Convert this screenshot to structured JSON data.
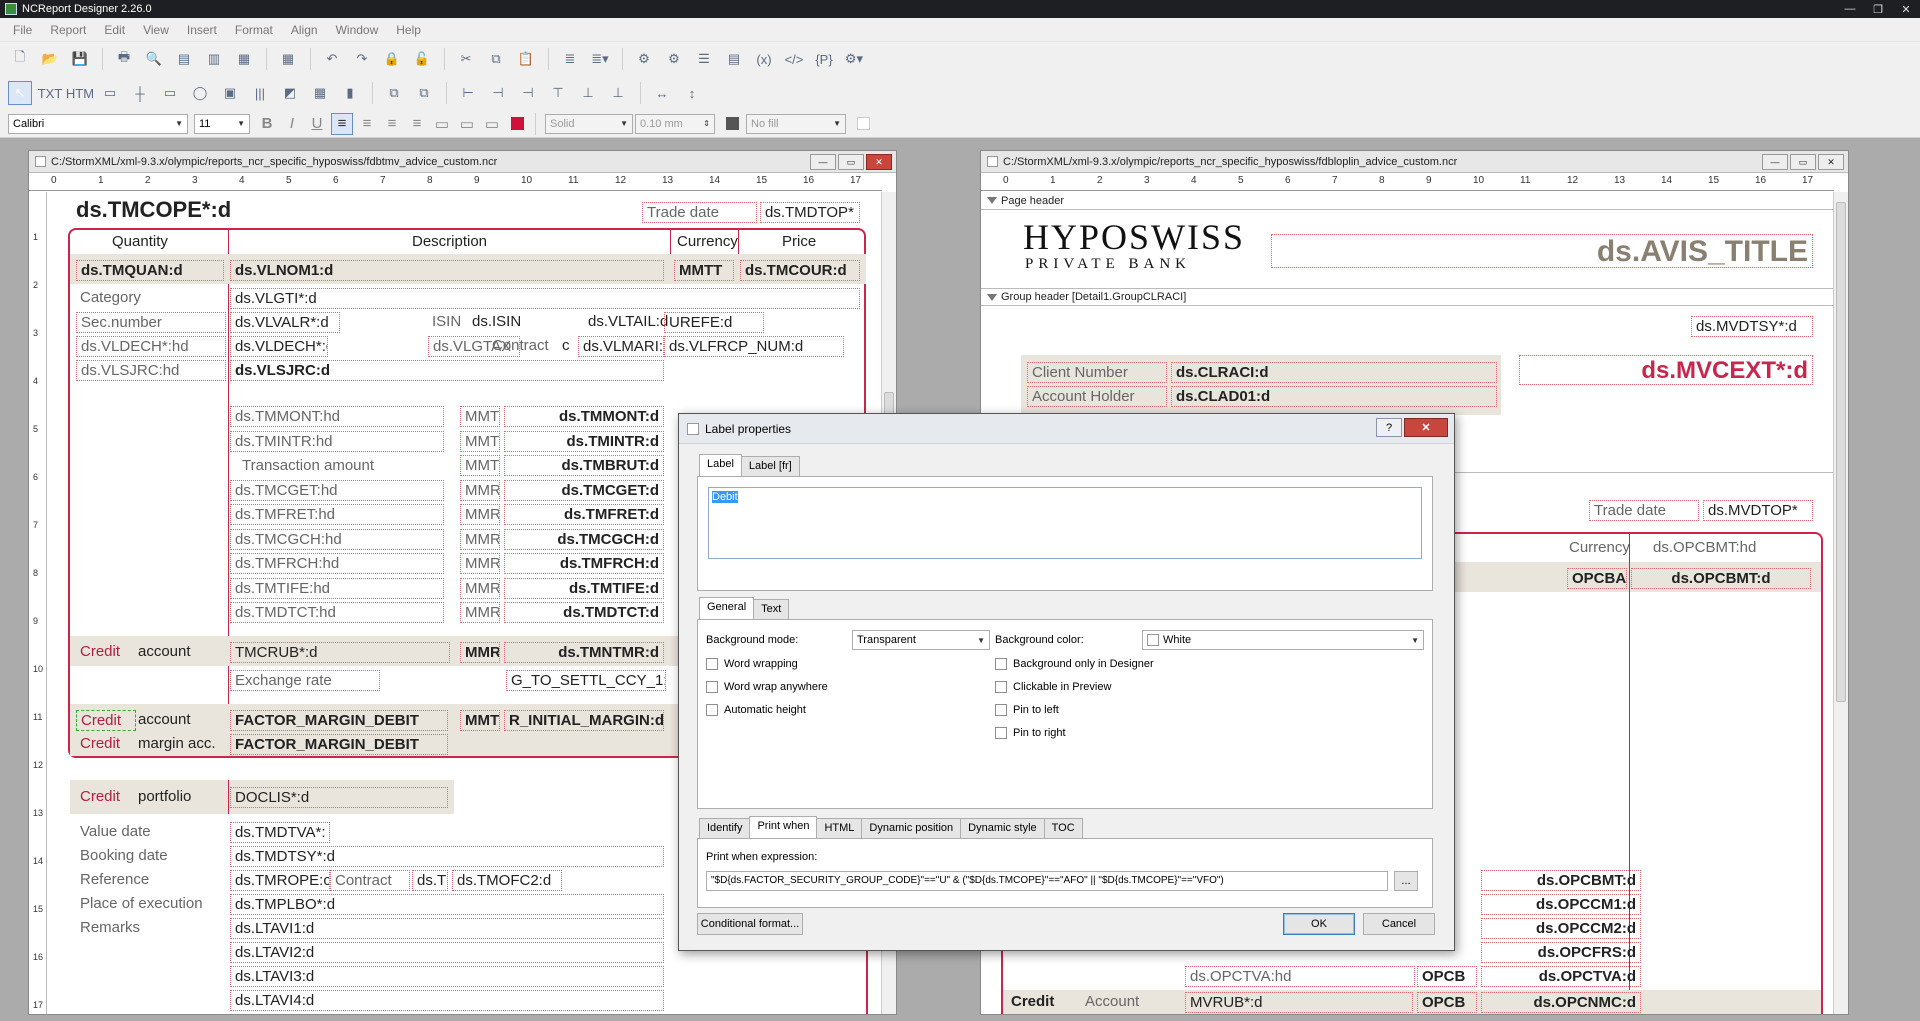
{
  "app_title": "NCReport Designer 2.26.0",
  "menu": [
    "File",
    "Report",
    "Edit",
    "View",
    "Insert",
    "Format",
    "Align",
    "Window",
    "Help"
  ],
  "format_toolbar": {
    "font": "Calibri",
    "size": "11",
    "line_style": "Solid",
    "line_width": "0.10 mm",
    "fill": "No fill"
  },
  "left_window": {
    "title": "C:/StormXML/xml-9.3.x/olympic/reports_ncr_specific_hyposwiss/fdbtmv_advice_custom.ncr",
    "ruler": [
      "0",
      "1",
      "2",
      "3",
      "4",
      "5",
      "6",
      "7",
      "8",
      "9",
      "10",
      "11",
      "12",
      "13",
      "14",
      "15",
      "16",
      "17"
    ],
    "vruler": [
      "1",
      "2",
      "3",
      "4",
      "5",
      "6",
      "7",
      "8",
      "9",
      "10",
      "11",
      "12",
      "13",
      "14",
      "15",
      "16",
      "17"
    ],
    "top_field": "ds.TMCOPE*:d",
    "trade_date_label": "Trade date",
    "trade_date_field": "ds.TMDTOP*",
    "headers": {
      "quantity": "Quantity",
      "description": "Description",
      "currency": "Currency",
      "price": "Price"
    },
    "row1": {
      "quan": "ds.TMQUAN:d",
      "nom": "ds.VLNOM1:d",
      "cur": "MMTT",
      "cour": "ds.TMCOUR:d"
    },
    "fields": {
      "category": "Category",
      "vlgti": "ds.VLGTI*:d",
      "secnumber": "Sec.number",
      "vlvalr": "ds.VLVALR*:d",
      "isin": "ISIN",
      "isin2": "ds.ISIN",
      "vltail": "ds.VLTAIL:d",
      "urefe": "UREFE:d",
      "vldech_hd": "ds.VLDECH*:hd",
      "vldech": "ds.VLDECH*:d",
      "vlgtax": "ds.VLGTAX",
      "contract": "Contract",
      "c": "c",
      "vlmari": "ds.VLMARI:d",
      "vlfrcp": "ds.VLFRCP_NUM:d",
      "vlsjrc_hd": "ds.VLSJRC:hd",
      "vlsjrc": "ds.VLSJRC:d",
      "exchange_rate": "Exchange rate",
      "settl": "G_TO_SETTL_CCY_1:d",
      "credit": "Credit",
      "debit": "Debit",
      "account": "account",
      "tmcrub": "TMCRUB*:d",
      "mmri": "MMRI",
      "tmntmr": "ds.TMNTMR:d",
      "factor1": "FACTOR_MARGIN_DEBIT",
      "factor2": "FACTOR_MARGIN_DEBIT",
      "mmt": "MMT",
      "initial": "R_INITIAL_MARGIN:d",
      "margin_acc": "margin acc.",
      "portfolio": "portfolio",
      "doclis": "DOCLIS*:d",
      "value_date": "Value date",
      "tmdtva": "ds.TMDTVA*:",
      "booking_date": "Booking date",
      "tmdtsy": "ds.TMDTSY*:d",
      "reference": "Reference",
      "tmrope": "ds.TMROPE:c",
      "contract2": "Contract",
      "dst": "ds.T",
      "tmofc2": "ds.TMOFC2:d",
      "place": "Place of execution",
      "tmplbo": "ds.TMPLBO*:d",
      "remarks": "Remarks",
      "ltavi1": "ds.LTAVI1:d",
      "ltavi2": "ds.LTAVI2:d",
      "ltavi3": "ds.LTAVI3:d",
      "ltavi4": "ds.LTAVI4:d",
      "transaction_amount": "Transaction amount"
    },
    "amount_rows": [
      {
        "hd": "ds.TMMONT:hd",
        "cur": "MMT",
        "val": "ds.TMMONT:d"
      },
      {
        "hd": "ds.TMINTR:hd",
        "cur": "MMT",
        "val": "ds.TMINTR:d"
      },
      {
        "hd": "",
        "cur": "MMT",
        "val": "ds.TMBRUT:d"
      },
      {
        "hd": "ds.TMCGET:hd",
        "cur": "MMRE",
        "val": "ds.TMCGET:d"
      },
      {
        "hd": "ds.TMFRET:hd",
        "cur": "MMRE",
        "val": "ds.TMFRET:d"
      },
      {
        "hd": "ds.TMCGCH:hd",
        "cur": "MMRE",
        "val": "ds.TMCGCH:d"
      },
      {
        "hd": "ds.TMFRCH:hd",
        "cur": "MMRE",
        "val": "ds.TMFRCH:d"
      },
      {
        "hd": "ds.TMTIFE:hd",
        "cur": "MMRE",
        "val": "ds.TMTIFE:d"
      },
      {
        "hd": "ds.TMDTCT:hd",
        "cur": "MMRE",
        "val": "ds.TMDTCT:d"
      }
    ]
  },
  "right_window": {
    "title": "C:/StormXML/xml-9.3.x/olympic/reports_ncr_specific_hyposwiss/fdbloplin_advice_custom.ncr",
    "ruler": [
      "0",
      "1",
      "2",
      "3",
      "4",
      "5",
      "6",
      "7",
      "8",
      "9",
      "10",
      "11",
      "12",
      "13",
      "14",
      "15",
      "16",
      "17"
    ],
    "page_header": "Page header",
    "logo_line1": "HYPOSWISS",
    "logo_line2": "PRIVATE BANK",
    "avis_title": "ds.AVIS_TITLE",
    "group_header": "Group header [Detail1.GroupCLRACI]",
    "mvdtsy": "ds.MVDTSY*:d",
    "client_number": "Client Number",
    "clraci": "ds.CLRACI:d",
    "account_holder": "Account Holder",
    "clad01": "ds.CLAD01:d",
    "mvcext": "ds.MVCEXT*:d",
    "trade_date": "Trade date",
    "mvdtop": "ds.MVDTOP*",
    "currency": "Currency",
    "opcbmt_hd": "ds.OPCBMT:hd",
    "opcba": "OPCBA",
    "opcbmt_d": "ds.OPCBMT:d",
    "bottom_vals": [
      "ds.OPCBMT:d",
      "ds.OPCCM1:d",
      "ds.OPCCM2:d",
      "ds.OPCFRS:d",
      "ds.OPCTVA:d"
    ],
    "opctva_hd": "ds.OPCTVA:hd",
    "opcb": "OPCB",
    "credit": "Credit",
    "account": "Account",
    "mvrub": "MVRUB*:d",
    "opcncm": "ds.OPCNMC:d"
  },
  "dialog": {
    "title": "Label properties",
    "help_btn": "?",
    "close_btn": "✕",
    "tabs": [
      "Label",
      "Label [fr]"
    ],
    "label_text": "Debit",
    "general_tabs": [
      "General",
      "Text"
    ],
    "bg_mode_label": "Background mode:",
    "bg_mode": "Transparent",
    "bg_color_label": "Background color:",
    "bg_color": "White",
    "left_checks": [
      "Word wrapping",
      "Word wrap anywhere",
      "Automatic height"
    ],
    "right_checks": [
      "Background only in Designer",
      "Clickable in Preview",
      "Pin to left",
      "Pin to right"
    ],
    "bottom_tabs": [
      "Identify",
      "Print when",
      "HTML",
      "Dynamic position",
      "Dynamic style",
      "TOC"
    ],
    "print_when_label": "Print when expression:",
    "print_when_expr": "\"$D{ds.FACTOR_SECURITY_GROUP_CODE}\"==\"U\" & (\"$D{ds.TMCOPE}\"==\"AFO\" || \"$D{ds.TMCOPE}\"==\"VFO\")",
    "browse": "...",
    "conditional_format": "Conditional format...",
    "ok": "OK",
    "cancel": "Cancel"
  }
}
